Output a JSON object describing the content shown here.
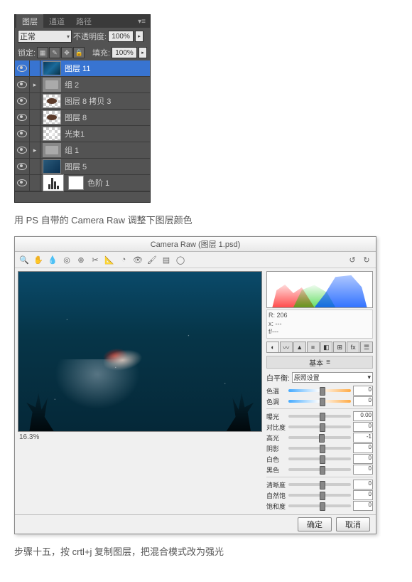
{
  "layers_panel": {
    "tabs": [
      "图层",
      "通道",
      "路径"
    ],
    "blend_mode": "正常",
    "opacity_label": "不透明度:",
    "opacity_value": "100%",
    "lock_label": "锁定:",
    "fill_label": "填充:",
    "fill_value": "100%",
    "layers": [
      {
        "name": "图层 11",
        "selected": true,
        "type": "img1"
      },
      {
        "name": "组 2",
        "type": "folder",
        "group": true
      },
      {
        "name": "图层 8 拷贝 3",
        "type": "check2"
      },
      {
        "name": "图层 8",
        "type": "check2"
      },
      {
        "name": "光束1",
        "type": "light"
      },
      {
        "name": "组 1",
        "type": "folder",
        "group": true
      },
      {
        "name": "图层 5",
        "type": "img5"
      },
      {
        "name": "色阶 1",
        "type": "adj",
        "mask": true
      }
    ]
  },
  "caption1": "用 PS 自带的 Camera Raw 调整下图层颜色",
  "camera_raw": {
    "title": "Camera Raw (图层 1.psd)",
    "zoom": "16.3%",
    "info": {
      "r": "R: 206",
      "x": "x: ---",
      "f": "f/---"
    },
    "section_basic": "基本",
    "wb_label": "白平衡:",
    "wb_value": "原照设置",
    "sliders": [
      {
        "label": "色温",
        "value": "0",
        "pos": 50,
        "color": true
      },
      {
        "label": "色调",
        "value": "0",
        "pos": 50,
        "color": true
      },
      {
        "label": "曝光",
        "value": "0.00",
        "pos": 50
      },
      {
        "label": "对比度",
        "value": "0",
        "pos": 50
      },
      {
        "label": "高光",
        "value": "-1",
        "pos": 49
      },
      {
        "label": "阴影",
        "value": "0",
        "pos": 50
      },
      {
        "label": "白色",
        "value": "0",
        "pos": 50
      },
      {
        "label": "黑色",
        "value": "0",
        "pos": 50
      },
      {
        "label": "清晰度",
        "value": "0",
        "pos": 50
      },
      {
        "label": "自然饱",
        "value": "0",
        "pos": 50
      },
      {
        "label": "饱和度",
        "value": "0",
        "pos": 50
      }
    ],
    "ok_btn": "确定",
    "cancel_btn": "取消"
  },
  "caption2": "步骤十五，按 crtl+j 复制图层，把混合模式改为强光"
}
